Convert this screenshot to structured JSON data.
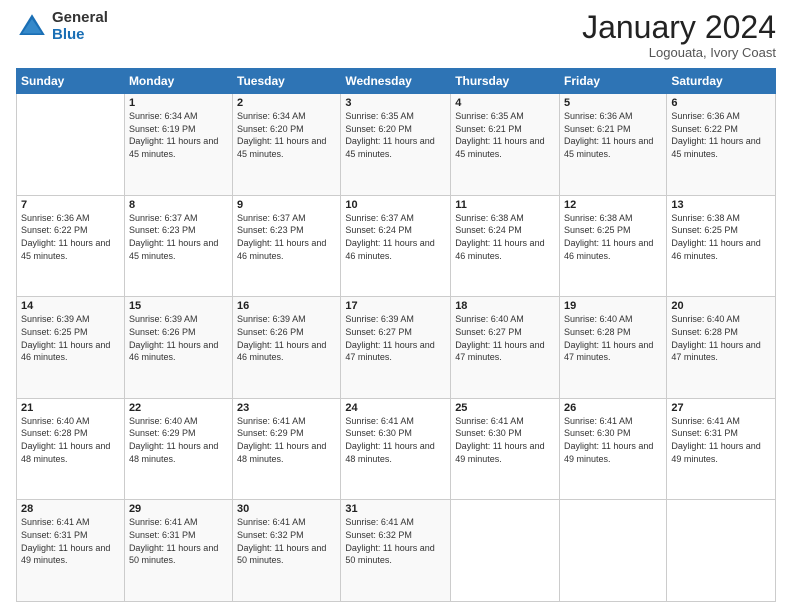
{
  "logo": {
    "general": "General",
    "blue": "Blue"
  },
  "header": {
    "month": "January 2024",
    "location": "Logouata, Ivory Coast"
  },
  "columns": [
    "Sunday",
    "Monday",
    "Tuesday",
    "Wednesday",
    "Thursday",
    "Friday",
    "Saturday"
  ],
  "weeks": [
    [
      {
        "day": "",
        "sunrise": "",
        "sunset": "",
        "daylight": ""
      },
      {
        "day": "1",
        "sunrise": "Sunrise: 6:34 AM",
        "sunset": "Sunset: 6:19 PM",
        "daylight": "Daylight: 11 hours and 45 minutes."
      },
      {
        "day": "2",
        "sunrise": "Sunrise: 6:34 AM",
        "sunset": "Sunset: 6:20 PM",
        "daylight": "Daylight: 11 hours and 45 minutes."
      },
      {
        "day": "3",
        "sunrise": "Sunrise: 6:35 AM",
        "sunset": "Sunset: 6:20 PM",
        "daylight": "Daylight: 11 hours and 45 minutes."
      },
      {
        "day": "4",
        "sunrise": "Sunrise: 6:35 AM",
        "sunset": "Sunset: 6:21 PM",
        "daylight": "Daylight: 11 hours and 45 minutes."
      },
      {
        "day": "5",
        "sunrise": "Sunrise: 6:36 AM",
        "sunset": "Sunset: 6:21 PM",
        "daylight": "Daylight: 11 hours and 45 minutes."
      },
      {
        "day": "6",
        "sunrise": "Sunrise: 6:36 AM",
        "sunset": "Sunset: 6:22 PM",
        "daylight": "Daylight: 11 hours and 45 minutes."
      }
    ],
    [
      {
        "day": "7",
        "sunrise": "Sunrise: 6:36 AM",
        "sunset": "Sunset: 6:22 PM",
        "daylight": "Daylight: 11 hours and 45 minutes."
      },
      {
        "day": "8",
        "sunrise": "Sunrise: 6:37 AM",
        "sunset": "Sunset: 6:23 PM",
        "daylight": "Daylight: 11 hours and 45 minutes."
      },
      {
        "day": "9",
        "sunrise": "Sunrise: 6:37 AM",
        "sunset": "Sunset: 6:23 PM",
        "daylight": "Daylight: 11 hours and 46 minutes."
      },
      {
        "day": "10",
        "sunrise": "Sunrise: 6:37 AM",
        "sunset": "Sunset: 6:24 PM",
        "daylight": "Daylight: 11 hours and 46 minutes."
      },
      {
        "day": "11",
        "sunrise": "Sunrise: 6:38 AM",
        "sunset": "Sunset: 6:24 PM",
        "daylight": "Daylight: 11 hours and 46 minutes."
      },
      {
        "day": "12",
        "sunrise": "Sunrise: 6:38 AM",
        "sunset": "Sunset: 6:25 PM",
        "daylight": "Daylight: 11 hours and 46 minutes."
      },
      {
        "day": "13",
        "sunrise": "Sunrise: 6:38 AM",
        "sunset": "Sunset: 6:25 PM",
        "daylight": "Daylight: 11 hours and 46 minutes."
      }
    ],
    [
      {
        "day": "14",
        "sunrise": "Sunrise: 6:39 AM",
        "sunset": "Sunset: 6:25 PM",
        "daylight": "Daylight: 11 hours and 46 minutes."
      },
      {
        "day": "15",
        "sunrise": "Sunrise: 6:39 AM",
        "sunset": "Sunset: 6:26 PM",
        "daylight": "Daylight: 11 hours and 46 minutes."
      },
      {
        "day": "16",
        "sunrise": "Sunrise: 6:39 AM",
        "sunset": "Sunset: 6:26 PM",
        "daylight": "Daylight: 11 hours and 46 minutes."
      },
      {
        "day": "17",
        "sunrise": "Sunrise: 6:39 AM",
        "sunset": "Sunset: 6:27 PM",
        "daylight": "Daylight: 11 hours and 47 minutes."
      },
      {
        "day": "18",
        "sunrise": "Sunrise: 6:40 AM",
        "sunset": "Sunset: 6:27 PM",
        "daylight": "Daylight: 11 hours and 47 minutes."
      },
      {
        "day": "19",
        "sunrise": "Sunrise: 6:40 AM",
        "sunset": "Sunset: 6:28 PM",
        "daylight": "Daylight: 11 hours and 47 minutes."
      },
      {
        "day": "20",
        "sunrise": "Sunrise: 6:40 AM",
        "sunset": "Sunset: 6:28 PM",
        "daylight": "Daylight: 11 hours and 47 minutes."
      }
    ],
    [
      {
        "day": "21",
        "sunrise": "Sunrise: 6:40 AM",
        "sunset": "Sunset: 6:28 PM",
        "daylight": "Daylight: 11 hours and 48 minutes."
      },
      {
        "day": "22",
        "sunrise": "Sunrise: 6:40 AM",
        "sunset": "Sunset: 6:29 PM",
        "daylight": "Daylight: 11 hours and 48 minutes."
      },
      {
        "day": "23",
        "sunrise": "Sunrise: 6:41 AM",
        "sunset": "Sunset: 6:29 PM",
        "daylight": "Daylight: 11 hours and 48 minutes."
      },
      {
        "day": "24",
        "sunrise": "Sunrise: 6:41 AM",
        "sunset": "Sunset: 6:30 PM",
        "daylight": "Daylight: 11 hours and 48 minutes."
      },
      {
        "day": "25",
        "sunrise": "Sunrise: 6:41 AM",
        "sunset": "Sunset: 6:30 PM",
        "daylight": "Daylight: 11 hours and 49 minutes."
      },
      {
        "day": "26",
        "sunrise": "Sunrise: 6:41 AM",
        "sunset": "Sunset: 6:30 PM",
        "daylight": "Daylight: 11 hours and 49 minutes."
      },
      {
        "day": "27",
        "sunrise": "Sunrise: 6:41 AM",
        "sunset": "Sunset: 6:31 PM",
        "daylight": "Daylight: 11 hours and 49 minutes."
      }
    ],
    [
      {
        "day": "28",
        "sunrise": "Sunrise: 6:41 AM",
        "sunset": "Sunset: 6:31 PM",
        "daylight": "Daylight: 11 hours and 49 minutes."
      },
      {
        "day": "29",
        "sunrise": "Sunrise: 6:41 AM",
        "sunset": "Sunset: 6:31 PM",
        "daylight": "Daylight: 11 hours and 50 minutes."
      },
      {
        "day": "30",
        "sunrise": "Sunrise: 6:41 AM",
        "sunset": "Sunset: 6:32 PM",
        "daylight": "Daylight: 11 hours and 50 minutes."
      },
      {
        "day": "31",
        "sunrise": "Sunrise: 6:41 AM",
        "sunset": "Sunset: 6:32 PM",
        "daylight": "Daylight: 11 hours and 50 minutes."
      },
      {
        "day": "",
        "sunrise": "",
        "sunset": "",
        "daylight": ""
      },
      {
        "day": "",
        "sunrise": "",
        "sunset": "",
        "daylight": ""
      },
      {
        "day": "",
        "sunrise": "",
        "sunset": "",
        "daylight": ""
      }
    ]
  ]
}
